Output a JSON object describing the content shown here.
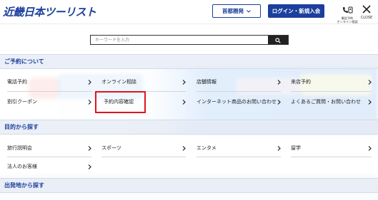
{
  "header": {
    "logo": "近畿日本ツーリスト",
    "region_button": "首都圏発",
    "login_button": "ログイン・新規入会",
    "phone_caption_1": "電話予約",
    "phone_caption_2": "オンライン相談",
    "close_caption": "CLOSE"
  },
  "search": {
    "placeholder": "キーワードを入力"
  },
  "sections": {
    "reservation": {
      "title": "ご予約について",
      "items": [
        "電話予約",
        "オンライン相談",
        "店舗情報",
        "来店予約",
        "割引クーポン",
        "予約内容確認",
        "インターネット商品のお問い合わせ",
        "よくあるご質問・お問い合わせ"
      ]
    },
    "purpose": {
      "title": "目的から探す",
      "items": [
        "旅行説明会",
        "スポーツ",
        "エンタメ",
        "留学",
        "法人のお客様"
      ]
    },
    "departure": {
      "title": "出発地から探す"
    }
  },
  "colors": {
    "brand": "#1b3f9c",
    "highlight": "#e0141e"
  }
}
